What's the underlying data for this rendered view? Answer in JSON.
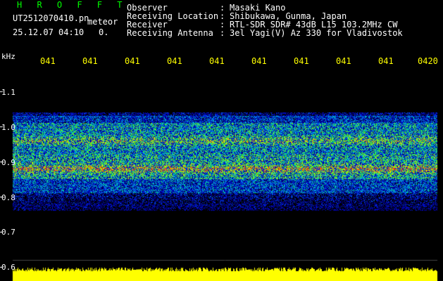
{
  "header": {
    "software": "H R O F F T",
    "filename": "UT2512070410.pn",
    "type_label": "meteor",
    "datetime": "25.12.07 04:10",
    "counter": "0.",
    "info": [
      {
        "key": "Observer",
        "value": "Masaki Kano"
      },
      {
        "key": "Receiving Location",
        "value": "Shibukawa, Gunma, Japan"
      },
      {
        "key": "Receiver",
        "value": "RTL-SDR SDR# 43dB L15 103.2MHz CW"
      },
      {
        "key": "Receiving Antenna",
        "value": "3el Yagi(V) Az 330 for Vladivostok"
      }
    ]
  },
  "axis": {
    "unit": "kHz",
    "freq_labels": [
      "1.1",
      "1.0",
      "0.9",
      "0.8",
      "0.7",
      "0.6"
    ],
    "minute_labels": [
      "041",
      "041",
      "041",
      "041",
      "041",
      "041",
      "041",
      "041",
      "041",
      "0420"
    ]
  },
  "colors": {
    "header_green": "#00ff00",
    "minute_yellow": "#ffff00",
    "baseline_yellow": "#ffff00",
    "background": "#000000"
  }
}
